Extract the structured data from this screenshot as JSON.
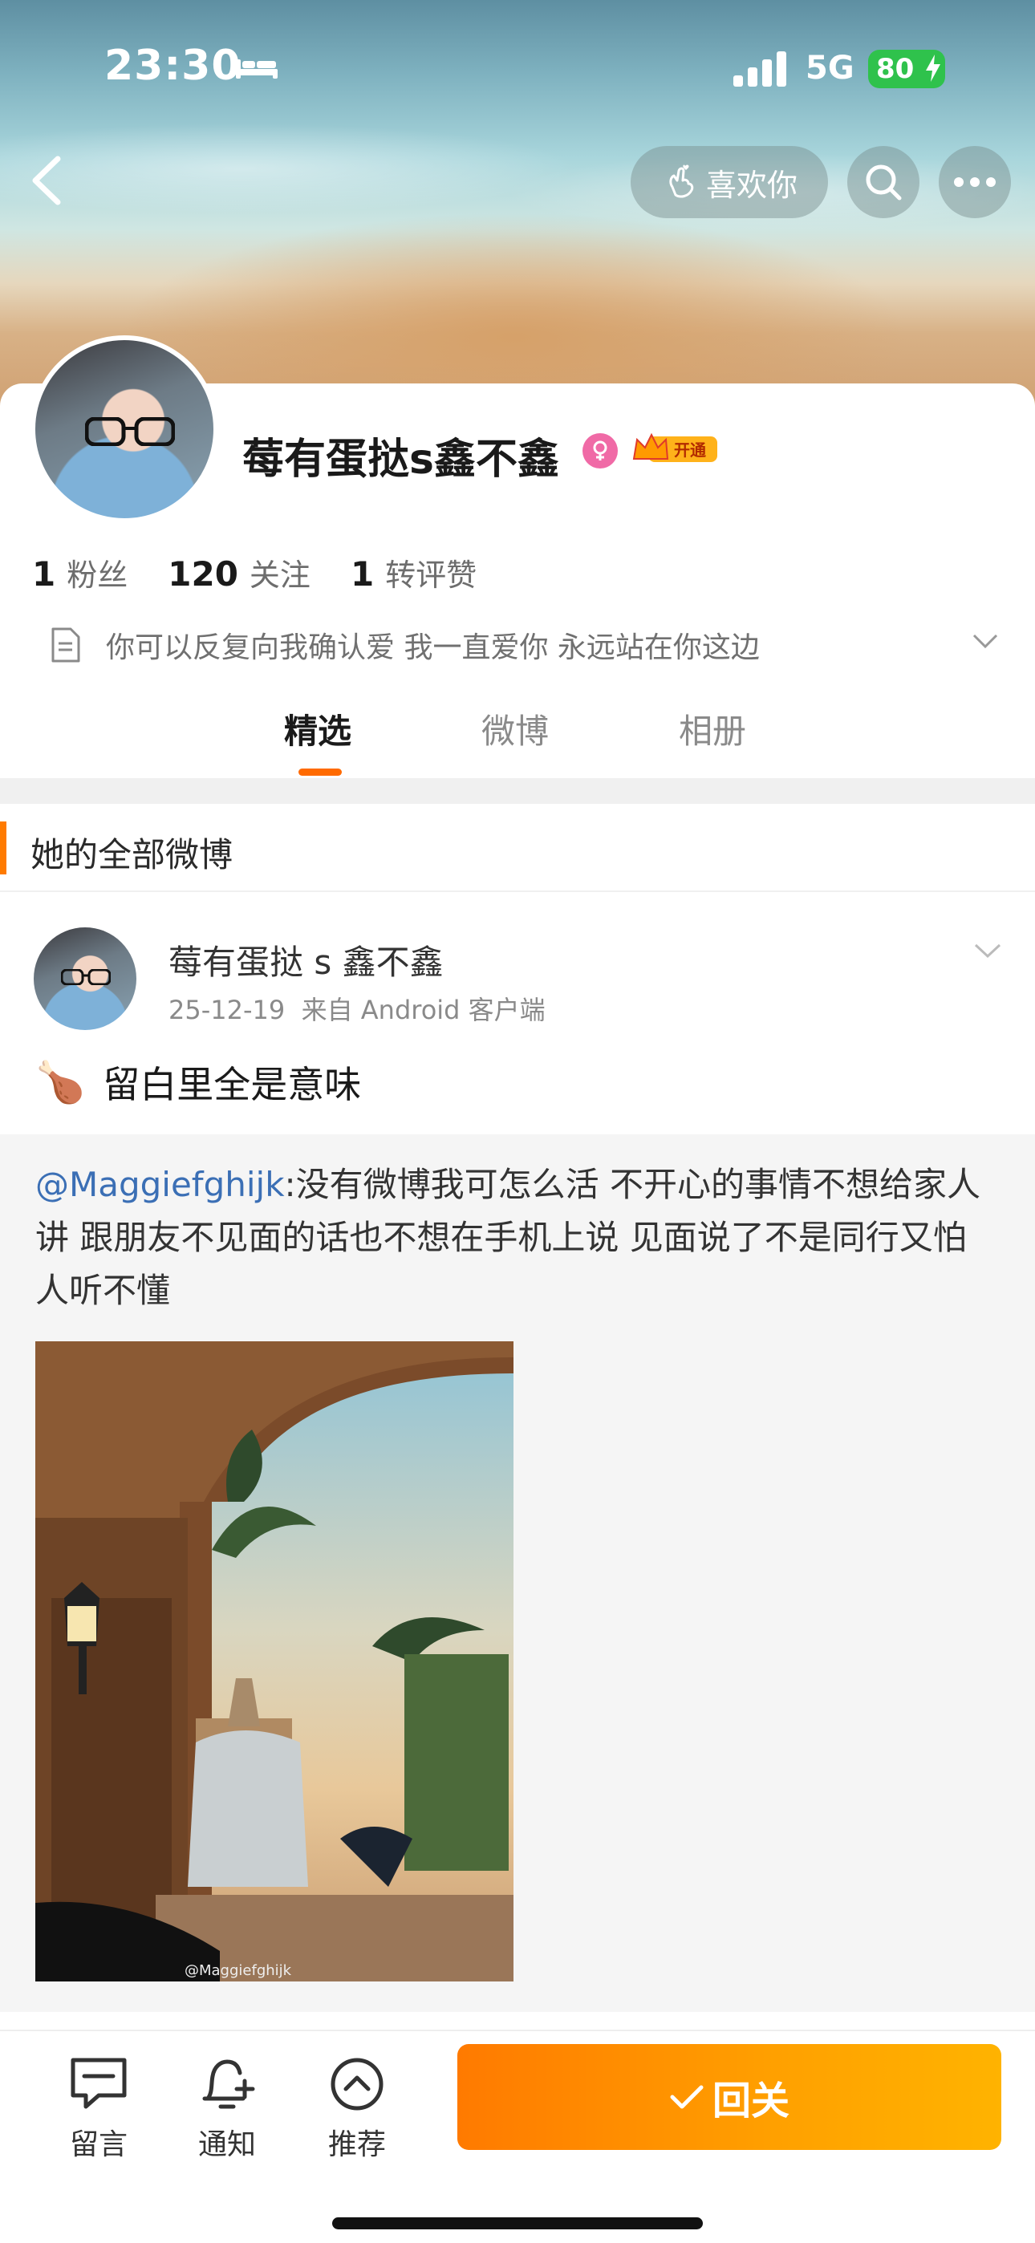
{
  "status_bar": {
    "time": "23:30",
    "network": "5G",
    "battery": "80"
  },
  "header": {
    "like_label": "喜欢你"
  },
  "profile": {
    "name": "莓有蛋挞s鑫不鑫",
    "vip_label": "开通",
    "stats": [
      {
        "value": "1",
        "label": "粉丝"
      },
      {
        "value": "120",
        "label": "关注"
      },
      {
        "value": "1",
        "label": "转评赞"
      }
    ],
    "bio": "你可以反复向我确认爱 我一直爱你 永远站在你这边"
  },
  "tabs": [
    "精选",
    "微博",
    "相册"
  ],
  "active_tab": "精选",
  "section_title": "她的全部微博",
  "post": {
    "author": "莓有蛋挞 s 鑫不鑫",
    "date": "25-12-19",
    "source": "来自 Android 客户端",
    "emoji": "🍗",
    "text": "留白里全是意味",
    "repost": {
      "mention": "@Maggiefghijk",
      "text": ":没有微博我可怎么活 不开心的事情不想给家人讲 跟朋友不见面的话也不想在手机上说 见面说了不是同行又怕人听不懂",
      "watermark": "@Maggiefghijk"
    }
  },
  "bottom_bar": {
    "items": [
      "留言",
      "通知",
      "推荐"
    ],
    "follow_label": "回关"
  },
  "colors": {
    "accent": "#ff7b00",
    "mention": "#3b6fb5",
    "battery": "#2fc24c"
  }
}
